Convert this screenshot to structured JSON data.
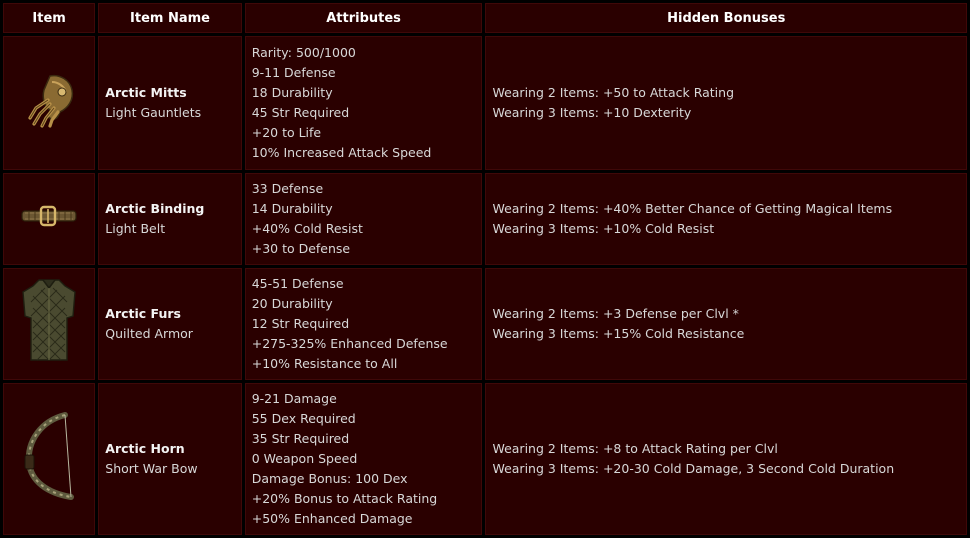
{
  "headers": {
    "item": "Item",
    "item_name": "Item Name",
    "attributes": "Attributes",
    "hidden_bonuses": "Hidden Bonuses"
  },
  "rows": [
    {
      "icon": "gauntlets-icon",
      "name": "Arctic Mitts",
      "type": "Light Gauntlets",
      "attributes": [
        "Rarity: 500/1000",
        "9-11 Defense",
        "18 Durability",
        "45 Str Required",
        "+20 to Life",
        "10% Increased Attack Speed"
      ],
      "bonuses": [
        "Wearing 2 Items: +50 to Attack Rating",
        "Wearing 3 Items: +10 Dexterity"
      ]
    },
    {
      "icon": "belt-icon",
      "name": "Arctic Binding",
      "type": "Light Belt",
      "attributes": [
        "33 Defense",
        "14 Durability",
        "+40% Cold Resist",
        "+30 to Defense"
      ],
      "bonuses": [
        "Wearing 2 Items: +40% Better Chance of Getting Magical Items",
        "Wearing 3 Items: +10% Cold Resist"
      ]
    },
    {
      "icon": "armor-icon",
      "name": "Arctic Furs",
      "type": "Quilted Armor",
      "attributes": [
        "45-51 Defense",
        "20 Durability",
        "12 Str Required",
        "+275-325% Enhanced Defense",
        "+10% Resistance to All"
      ],
      "bonuses": [
        "Wearing 2 Items: +3 Defense per Clvl *",
        "Wearing 3 Items: +15% Cold Resistance"
      ]
    },
    {
      "icon": "bow-icon",
      "name": "Arctic Horn",
      "type": "Short War Bow",
      "attributes": [
        "9-21 Damage",
        "55 Dex Required",
        "35 Str Required",
        "0 Weapon Speed",
        "Damage Bonus: 100 Dex",
        "+20% Bonus to Attack Rating",
        "+50% Enhanced Damage"
      ],
      "bonuses": [
        "Wearing 2 Items: +8 to Attack Rating per Clvl",
        "Wearing 3 Items: +20-30 Cold Damage, 3 Second Cold Duration"
      ]
    }
  ]
}
